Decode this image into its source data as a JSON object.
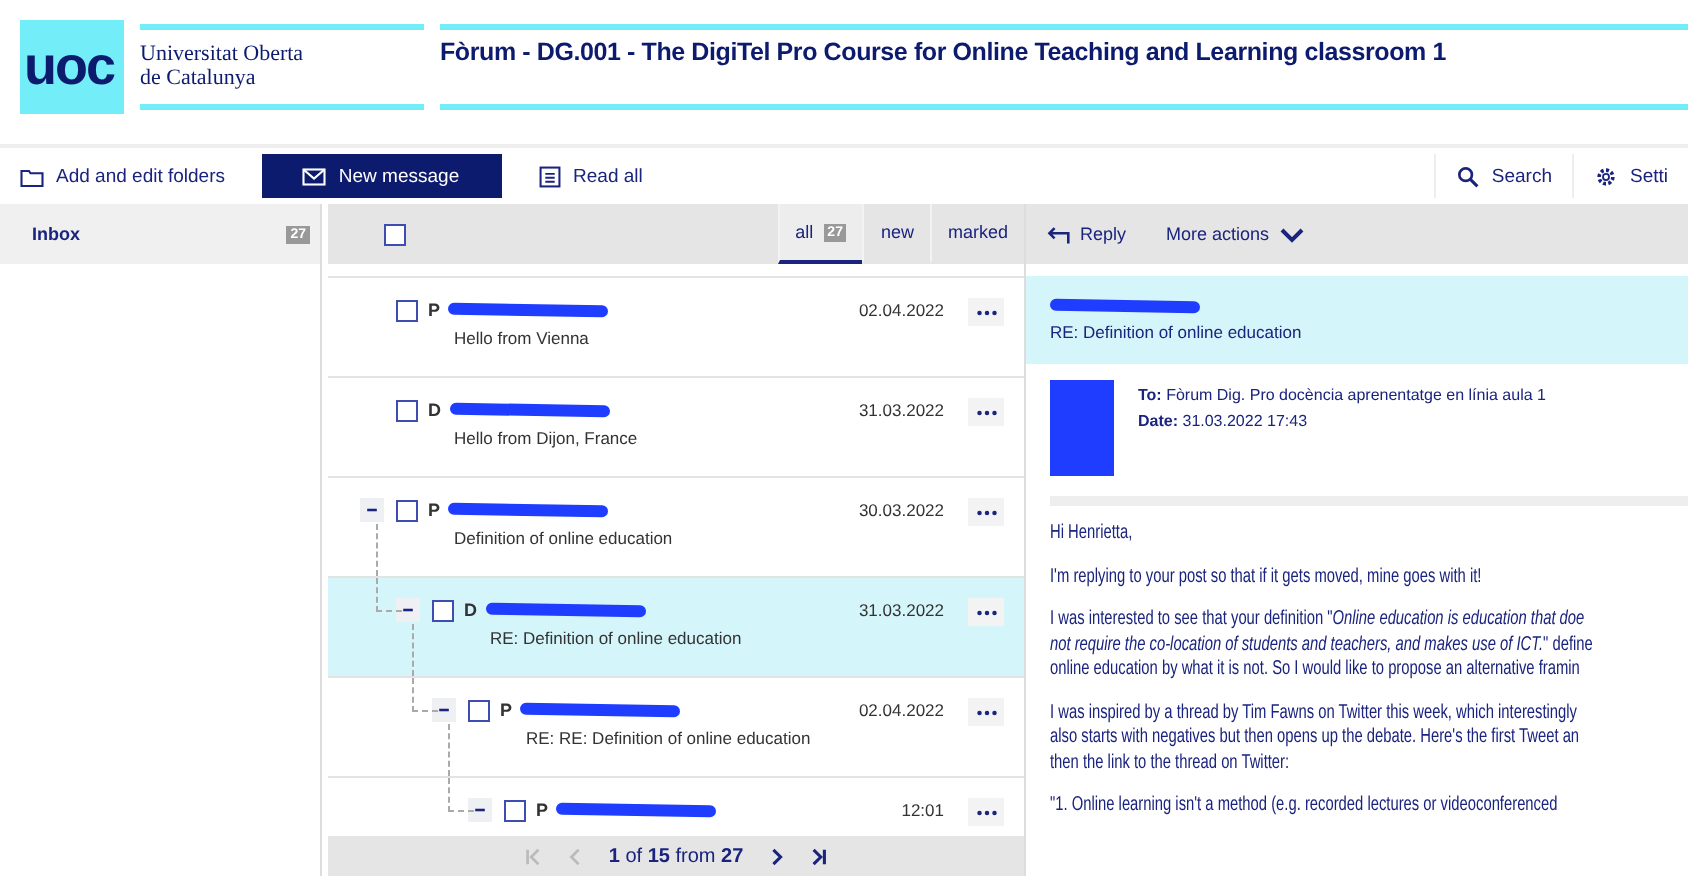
{
  "header": {
    "logo_mark": "uoc",
    "logo_lines": [
      "Universitat Oberta",
      "de Catalunya"
    ],
    "title": "Fòrum - DG.001 - The DigiTel Pro Course for Online Teaching and Learning classroom 1"
  },
  "toolbar": {
    "left": [
      {
        "kind": "folder",
        "label": "Add and edit folders"
      },
      {
        "kind": "primary",
        "label": "New message"
      },
      {
        "kind": "read",
        "label": "Read all"
      }
    ],
    "right": [
      {
        "kind": "search",
        "label": "Search"
      },
      {
        "kind": "settings",
        "label": "Setti"
      }
    ]
  },
  "sidebar": {
    "items": [
      {
        "label": "Inbox",
        "count": "27",
        "selected": true
      }
    ]
  },
  "list_header": {
    "select_all_checked": false,
    "tabs": [
      {
        "label": "all",
        "count": "27",
        "selected": true
      },
      {
        "label": "new",
        "selected": false
      },
      {
        "label": "marked",
        "selected": false
      }
    ]
  },
  "messages": [
    {
      "initial": "P",
      "subject": "Hello from Vienna",
      "date": "02.04.2022",
      "checked": false,
      "selected": false
    },
    {
      "initial": "D",
      "subject": "Hello from Dijon, France",
      "date": "31.03.2022",
      "checked": false,
      "selected": false
    },
    {
      "initial": "P",
      "subject": "Definition of online education",
      "date": "30.03.2022",
      "checked": false,
      "selected": false,
      "expanded": true,
      "children": [
        {
          "initial": "D",
          "subject": "RE: Definition of online education",
          "date": "31.03.2022",
          "checked": false,
          "selected": true,
          "expanded": true,
          "children": [
            {
              "initial": "P",
              "subject": "RE: RE: Definition of online education",
              "date": "02.04.2022",
              "checked": false,
              "selected": false,
              "expanded": true,
              "children": [
                {
                  "initial": "P",
                  "date": "12:01",
                  "checked": false,
                  "selected": false,
                  "expanded": true
                }
              ]
            }
          ]
        }
      ]
    }
  ],
  "pager": {
    "page": "1",
    "of_label": "of",
    "pages": "15",
    "from_label": "from",
    "total": "27",
    "first_disabled": true,
    "prev_disabled": true,
    "next_disabled": false,
    "last_disabled": false
  },
  "reader": {
    "actions": [
      {
        "kind": "reply",
        "label": "Reply"
      },
      {
        "kind": "more",
        "label": "More actions"
      }
    ],
    "subject": "RE: Definition of online education",
    "to_label": "To:",
    "to": "Fòrum Dig. Pro docència aprenentatge en línia aula 1",
    "date_label": "Date:",
    "date": "31.03.2022 17:43",
    "paragraphs": [
      [
        "Hi Henrietta,"
      ],
      [
        "I'm replying to your post so that if it gets moved, mine goes with it!"
      ],
      [
        "I was interested to see that your definition \"*Online education is education that doe*",
        "*not require the co-location of students and teachers, and makes use of ICT.*\" define",
        "online education by what it is not. So I would like to propose an alternative framin"
      ],
      [
        "I was inspired by a thread by Tim Fawns on Twitter this week, which interestingly",
        "also starts with negatives but then opens up the debate. Here's the first Tweet an",
        "then the link to the thread on Twitter:"
      ],
      [
        "\"1. Online learning isn't a method (e.g. recorded lectures or videoconferenced"
      ]
    ]
  }
}
